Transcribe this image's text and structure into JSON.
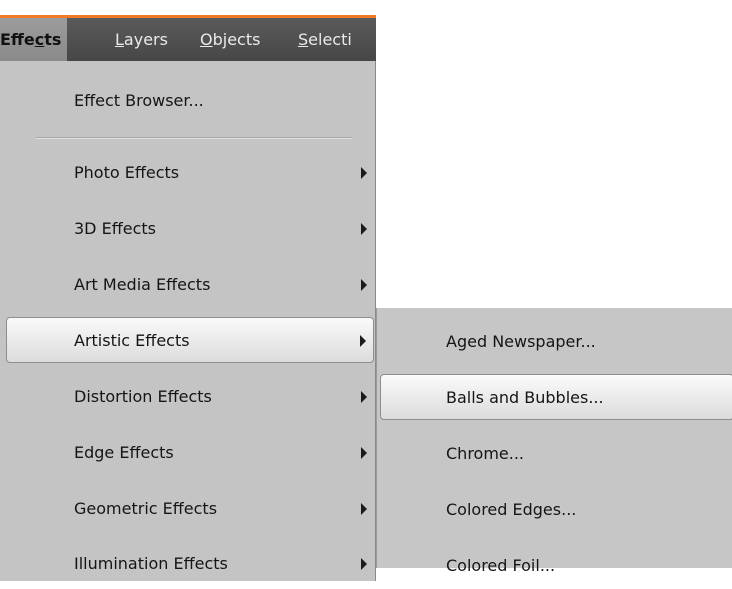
{
  "menubar": {
    "effects": {
      "pre": "Effe",
      "acc": "c",
      "post": "ts"
    },
    "layers": {
      "pre": "",
      "acc": "L",
      "post": "ayers"
    },
    "objects": {
      "pre": "",
      "acc": "O",
      "post": "bjects"
    },
    "selections": {
      "pre": "",
      "acc": "S",
      "post": "electi"
    }
  },
  "effects_menu": {
    "effect_browser": "Effect Browser...",
    "photo_effects": "Photo Effects",
    "3d_effects": "3D Effects",
    "art_media_effects": "Art Media Effects",
    "artistic_effects": "Artistic Effects",
    "distortion_effects": "Distortion Effects",
    "edge_effects": "Edge Effects",
    "geometric_effects": "Geometric Effects",
    "illumination_effects": "Illumination Effects"
  },
  "artistic_submenu": {
    "aged_newspaper": "Aged Newspaper...",
    "balls_and_bubbles": "Balls and Bubbles...",
    "chrome": "Chrome...",
    "colored_edges": "Colored Edges...",
    "colored_foil": "Colored Foil..."
  },
  "icons": {
    "submenu_arrow": "triangle-right-icon"
  },
  "colors": {
    "accent": "#f07a2a",
    "menubar": "#4f4f4f",
    "menu_bg": "#c4c4c4"
  }
}
